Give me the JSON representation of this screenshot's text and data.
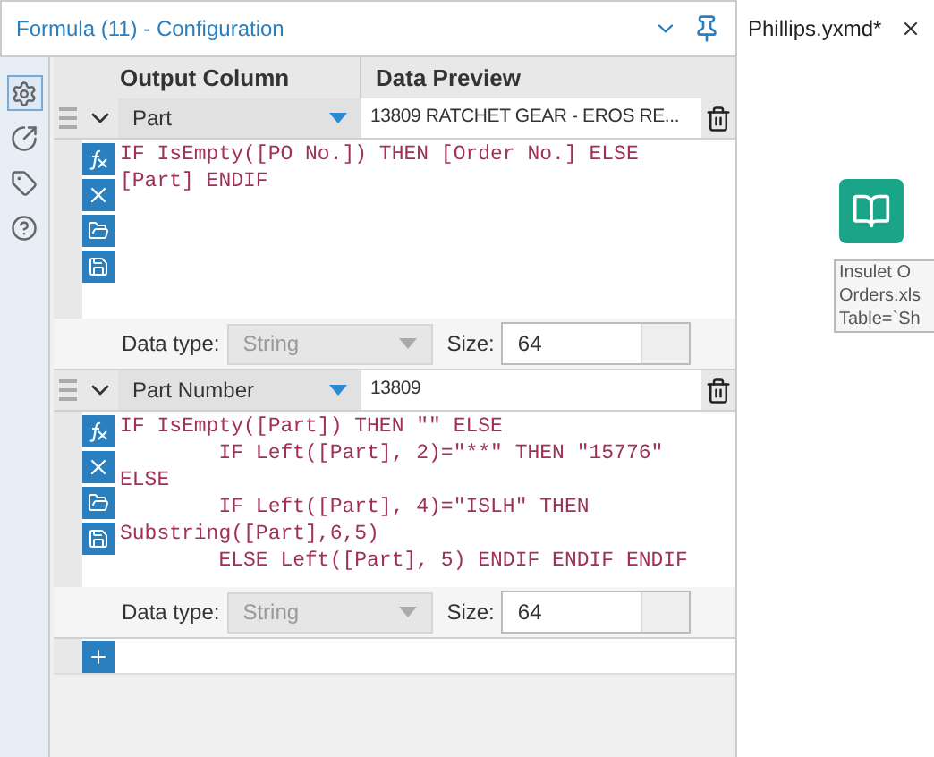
{
  "panel": {
    "title": "Formula (11) - Configuration"
  },
  "sidebar": {
    "items": [
      {
        "selected": true
      },
      {
        "selected": false
      },
      {
        "selected": false
      },
      {
        "selected": false
      }
    ]
  },
  "table": {
    "columns": [
      "Output Column",
      "Data Preview"
    ],
    "rows": [
      {
        "column": "Part",
        "preview": "13809 RATCHET GEAR - EROS RE...",
        "code": [
          "IF IsEmpty([PO No.]) THEN [Order No.] ELSE",
          "[Part] ENDIF"
        ],
        "data_type_label": "Data type:",
        "data_type": "String",
        "size_label": "Size:",
        "size": "64"
      },
      {
        "column": "Part Number",
        "preview": "13809",
        "code": [
          "IF IsEmpty([Part]) THEN \"\" ELSE",
          "        IF Left([Part], 2)=\"**\" THEN \"15776\"",
          "ELSE",
          "        IF Left([Part], 4)=\"ISLH\" THEN",
          "Substring([Part],6,5)",
          "        ELSE Left([Part], 5) ENDIF ENDIF ENDIF"
        ],
        "data_type_label": "Data type:",
        "data_type": "String",
        "size_label": "Size:",
        "size": "64"
      }
    ]
  },
  "canvas": {
    "tab": "Phillips.yxmd*",
    "annotation": [
      "Insulet O",
      "Orders.xls",
      "Table=`Sh"
    ]
  }
}
